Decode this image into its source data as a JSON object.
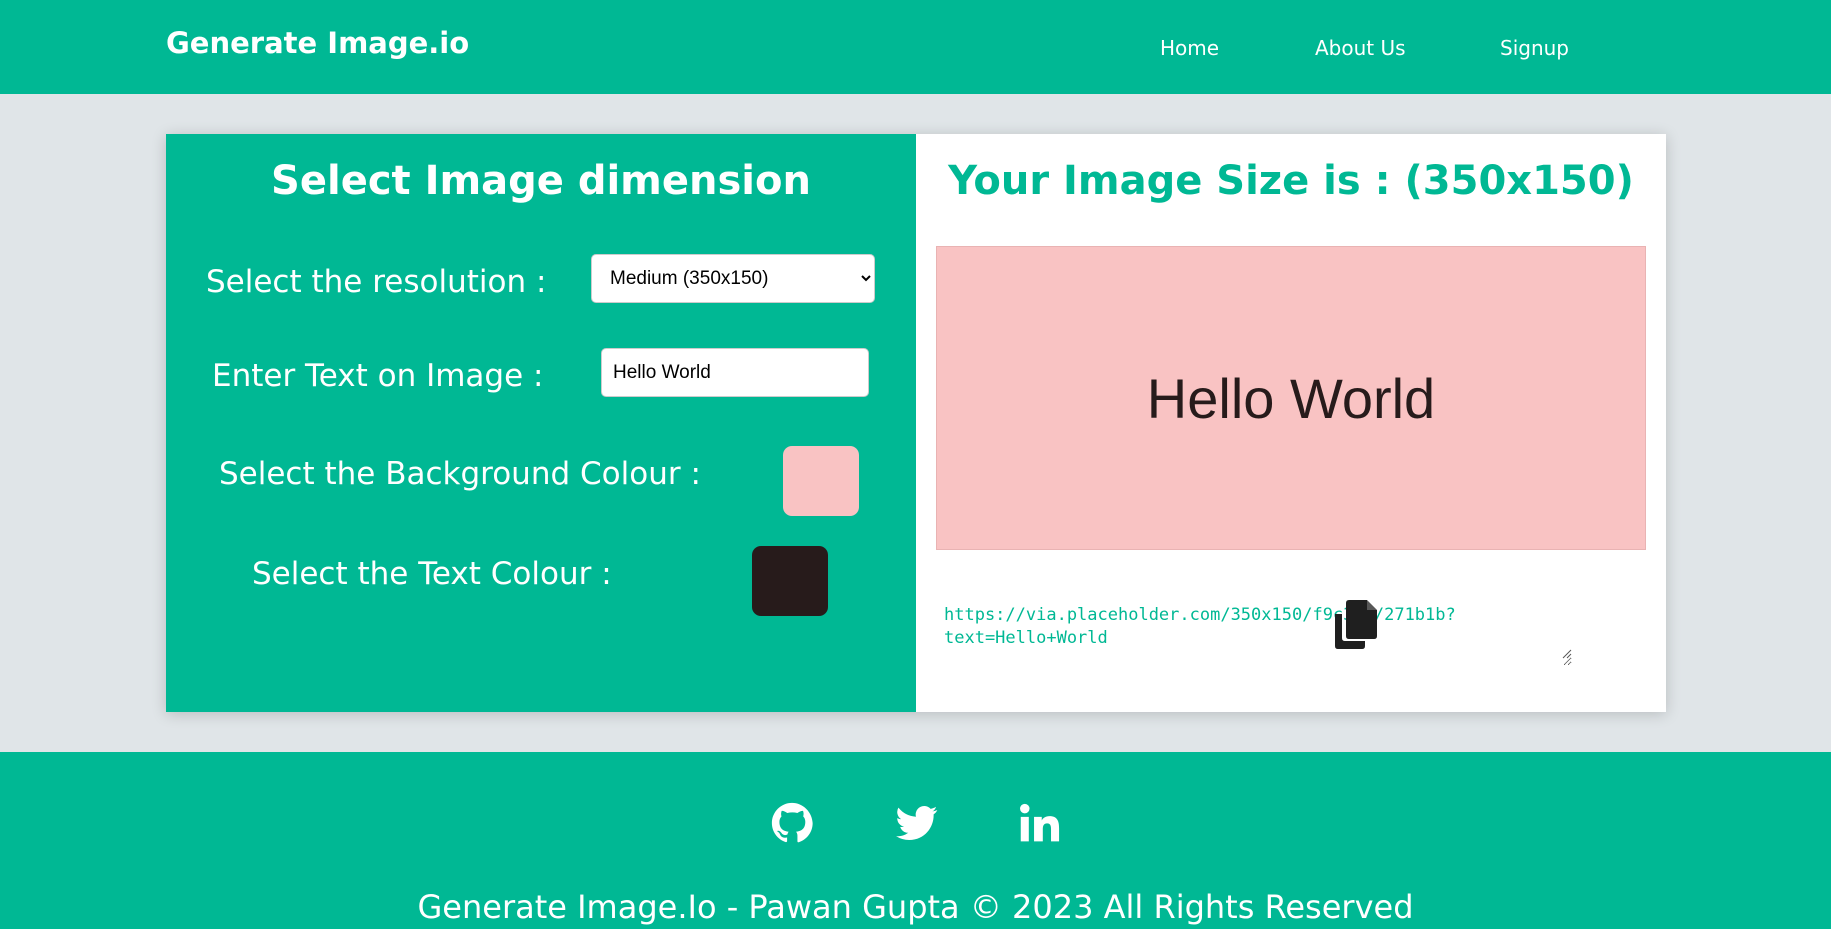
{
  "header": {
    "brand": "Generate Image.io",
    "nav": [
      "Home",
      "About Us",
      "Signup"
    ]
  },
  "left_panel": {
    "title": "Select Image dimension",
    "resolution_label": "Select the resolution :",
    "resolution_selected": "Medium (350x150)",
    "text_label": "Enter Text on Image :",
    "text_value": "Hello World",
    "bg_color_label": "Select the Background Colour :",
    "bg_color": "#f9c3c3",
    "text_color_label": "Select the Text Colour :",
    "text_color": "#271b1b"
  },
  "right_panel": {
    "title": "Your Image Size is : (350x150)",
    "preview_text": "Hello World",
    "url_line1": "https://via.placeholder.com/350x150/f9c3c3/271b1b?",
    "url_line2": "text=Hello+World"
  },
  "footer": {
    "social": [
      "github-icon",
      "twitter-icon",
      "linkedin-icon"
    ],
    "copyright": "Generate Image.Io - Pawan Gupta © 2023 All Rights Reserved"
  },
  "colors": {
    "accent": "#00b894",
    "page_bg": "#e0e5e8"
  }
}
